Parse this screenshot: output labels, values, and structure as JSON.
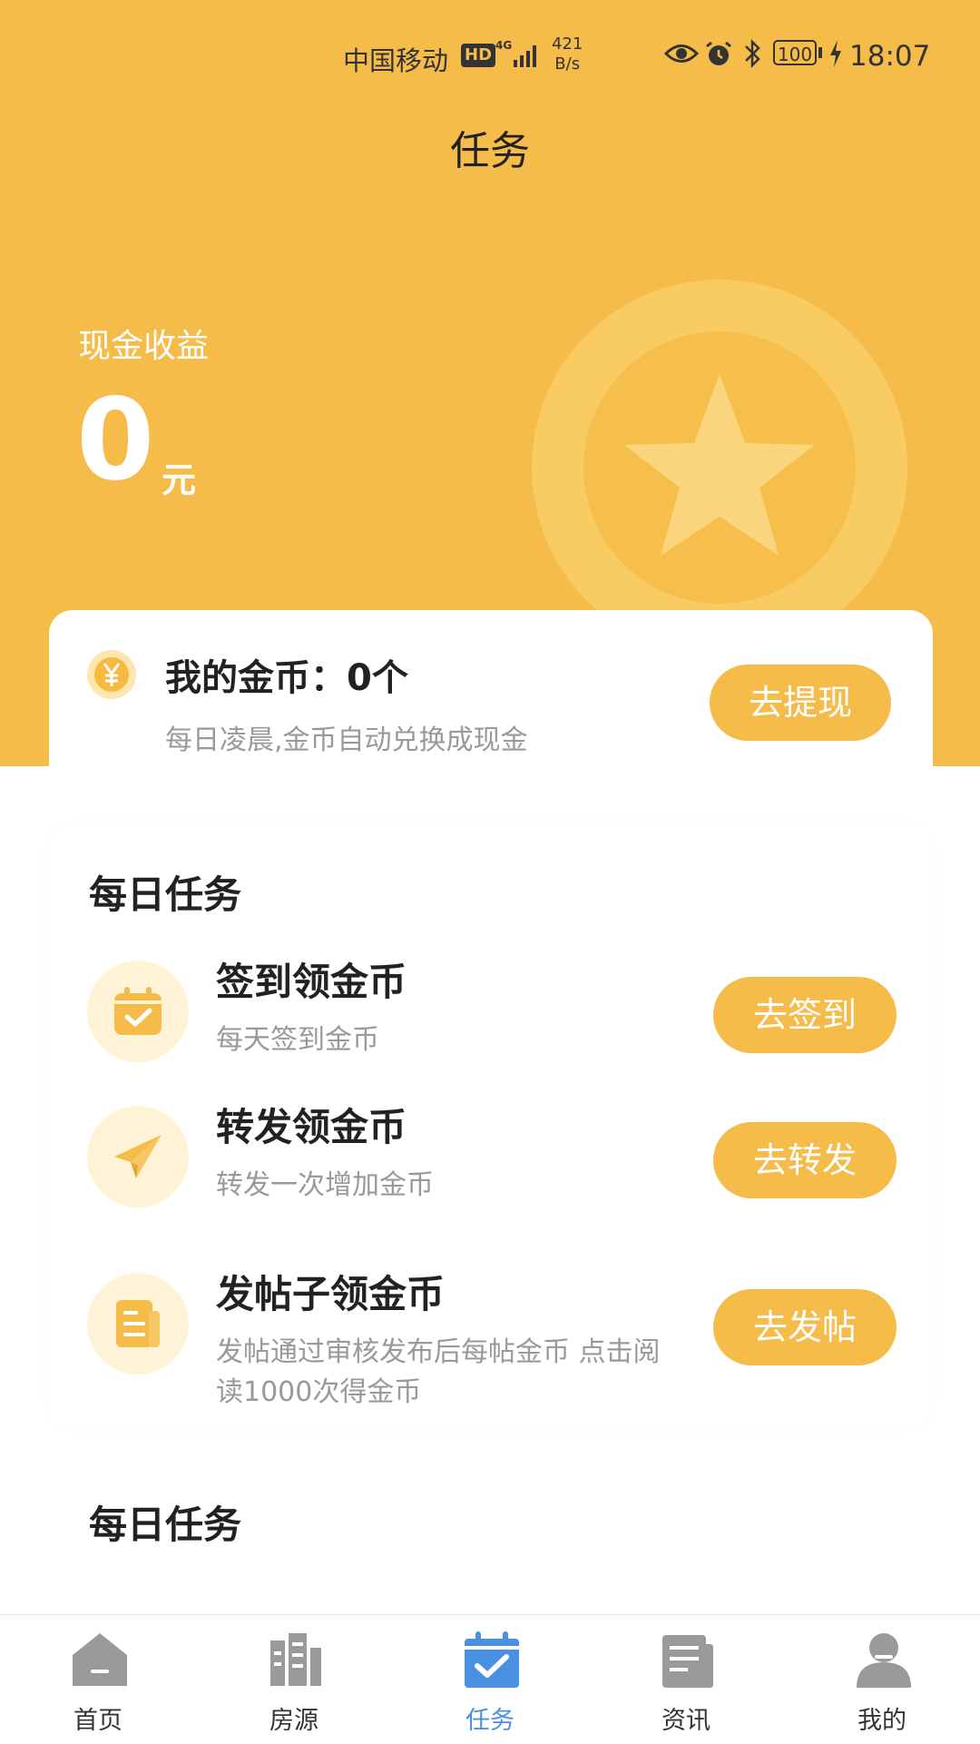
{
  "colors": {
    "accent": "#F5BC4A",
    "tab_active": "#4A90E2",
    "tab_inactive": "#9A9A9A"
  },
  "status_bar": {
    "carrier": "中国移动",
    "hd": "HD",
    "network": "4G",
    "speed_value": "421",
    "speed_unit": "B/s",
    "battery": "100",
    "time": "18:07",
    "icons": [
      "eye-icon",
      "alarm-icon",
      "bluetooth-icon",
      "battery-icon",
      "charging-icon"
    ]
  },
  "header": {
    "title": "任务"
  },
  "earnings": {
    "label": "现金收益",
    "value": "0",
    "unit": "元"
  },
  "coins": {
    "title": "我的金币：0个",
    "subtitle": "每日凌晨,金币自动兑换成现金",
    "button": "去提现"
  },
  "daily_tasks": {
    "title": "每日任务",
    "items": [
      {
        "title": "签到领金币",
        "desc": "每天签到金币",
        "button": "去签到",
        "icon": "calendar-check-icon"
      },
      {
        "title": "转发领金币",
        "desc": "转发一次增加金币",
        "button": "去转发",
        "icon": "paper-plane-icon"
      },
      {
        "title": "发帖子领金币",
        "desc": "发帖通过审核发布后每帖金币 点击阅读1000次得金币",
        "button": "去发帖",
        "icon": "document-icon"
      }
    ]
  },
  "daily_tasks_2": {
    "title": "每日任务"
  },
  "bottom_nav": {
    "active_index": 2,
    "items": [
      {
        "label": "首页",
        "icon": "home-icon"
      },
      {
        "label": "房源",
        "icon": "buildings-icon"
      },
      {
        "label": "任务",
        "icon": "calendar-check-icon"
      },
      {
        "label": "资讯",
        "icon": "news-icon"
      },
      {
        "label": "我的",
        "icon": "user-icon"
      }
    ]
  }
}
